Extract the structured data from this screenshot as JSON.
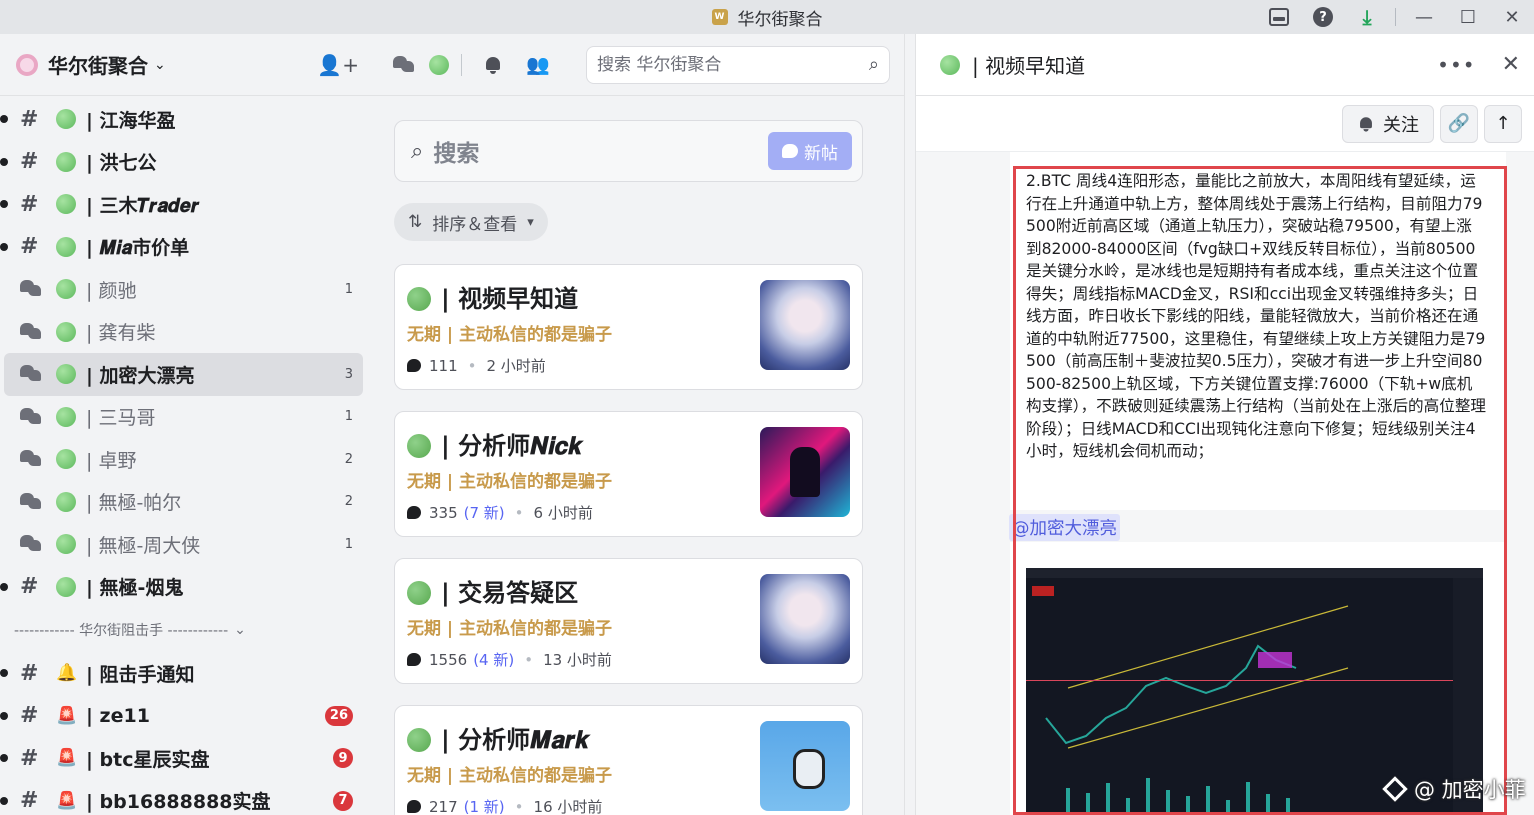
{
  "window": {
    "title": "华尔街聚合"
  },
  "server": {
    "name": "华尔街聚合"
  },
  "channels": [
    {
      "name": "| 江海华盈",
      "type": "text",
      "unread": true,
      "muted": false,
      "emoji": "",
      "count": "",
      "badge": ""
    },
    {
      "name": "| 洪七公",
      "type": "text",
      "unread": true,
      "muted": false,
      "emoji": "",
      "count": "",
      "badge": ""
    },
    {
      "name": "| 三木𝑻𝒓𝒂𝒅𝒆𝒓",
      "type": "text",
      "unread": true,
      "muted": false,
      "emoji": "",
      "count": "",
      "badge": ""
    },
    {
      "name": "| 𝑴𝒊𝒂市价单",
      "type": "text",
      "unread": true,
      "muted": false,
      "emoji": "",
      "count": "",
      "badge": ""
    },
    {
      "name": "| 颜驰",
      "type": "forum",
      "unread": false,
      "muted": true,
      "emoji": "",
      "count": "1",
      "badge": ""
    },
    {
      "name": "| 龚有柴",
      "type": "forum",
      "unread": false,
      "muted": true,
      "emoji": "",
      "count": "",
      "badge": ""
    },
    {
      "name": "| 加密大漂亮",
      "type": "forum",
      "unread": false,
      "muted": false,
      "selected": true,
      "emoji": "",
      "count": "3",
      "badge": ""
    },
    {
      "name": "| 三马哥",
      "type": "forum",
      "unread": false,
      "muted": true,
      "emoji": "",
      "count": "1",
      "badge": ""
    },
    {
      "name": "| 卓野",
      "type": "forum",
      "unread": false,
      "muted": true,
      "emoji": "",
      "count": "2",
      "badge": ""
    },
    {
      "name": "| 無極-帕尔",
      "type": "forum",
      "unread": false,
      "muted": true,
      "emoji": "",
      "count": "2",
      "badge": ""
    },
    {
      "name": "| 無極-周大侠",
      "type": "forum",
      "unread": false,
      "muted": true,
      "emoji": "",
      "count": "1",
      "badge": ""
    },
    {
      "name": "| 無極-烟鬼",
      "type": "text",
      "unread": true,
      "muted": false,
      "emoji": "",
      "count": "",
      "badge": ""
    }
  ],
  "category": {
    "label": "------------ 华尔街阻击手 ------------"
  },
  "channels2": [
    {
      "name": "| 阻击手通知",
      "type": "text",
      "unread": true,
      "emoji": "🔔",
      "badge": ""
    },
    {
      "name": "| ze11",
      "type": "text",
      "unread": true,
      "emoji": "🚨",
      "badge": "26"
    },
    {
      "name": "| btc星辰实盘",
      "type": "text",
      "unread": true,
      "emoji": "🚨",
      "badge": "9"
    },
    {
      "name": "| bb16888888实盘",
      "type": "text",
      "unread": true,
      "emoji": "🚨",
      "badge": "7"
    }
  ],
  "forum": {
    "search_placeholder": "搜索 华尔街聚合",
    "big_search": "搜索",
    "new_post": "新帖",
    "sort_label": "排序＆查看",
    "posts": [
      {
        "title": "| 视频早知道",
        "tag": "无期 | 主动私信的都是骗子",
        "replies": "111",
        "new": "",
        "time": "2 小时前"
      },
      {
        "title": "| 分析师𝑵𝒊𝒄𝒌",
        "tag": "无期 | 主动私信的都是骗子",
        "replies": "335",
        "new": "(7 新)",
        "time": "6 小时前"
      },
      {
        "title": "| 交易答疑区",
        "tag": "无期 | 主动私信的都是骗子",
        "replies": "1556",
        "new": "(4 新)",
        "time": "13 小时前"
      },
      {
        "title": "| 分析师𝑴𝒂𝒓𝒌",
        "tag": "无期 | 主动私信的都是骗子",
        "replies": "217",
        "new": "(1 新)",
        "time": "16 小时前"
      }
    ]
  },
  "thread": {
    "title": "| 视频早知道",
    "follow": "关注",
    "message": "2.BTC 周线4连阳形态，量能比之前放大，本周阳线有望延续，运行在上升通道中轨上方，整体周线处于震荡上行结构，目前阻力79500附近前高区域（通道上轨压力），突破站稳79500，有望上涨到82000-84000区间（fvg缺口+双线反转目标位），当前80500是关键分水岭，是冰线也是短期持有者成本线，重点关注这个位置得失；周线指标MACD金叉，RSI和cci出现金叉转强维持多头；日线方面，昨日收长下影线的阳线，量能轻微放大，当前价格还在通道的中轨附近77500，这里稳住，有望继续上攻上方关键阻力是79500（前高压制＋斐波拉契0.5压力），突破才有进一步上升空间80500-82500上轨区域，下方关键位置支撑:76000（下轨+w底机构支撑），不跌破则延续震荡上行结构（当前处在上涨后的高位整理阶段）；日线MACD和CCI出现钝化注意向下修复；短线级别关注4小时，短线机会伺机而动；",
    "mention": "@加密大漂亮",
    "watermark": "@ 加密小菲"
  },
  "colors": {
    "accent": "#5865f2",
    "tag": "#c89a4b",
    "badge": "#da373c",
    "highlight_box": "#e0464b"
  }
}
